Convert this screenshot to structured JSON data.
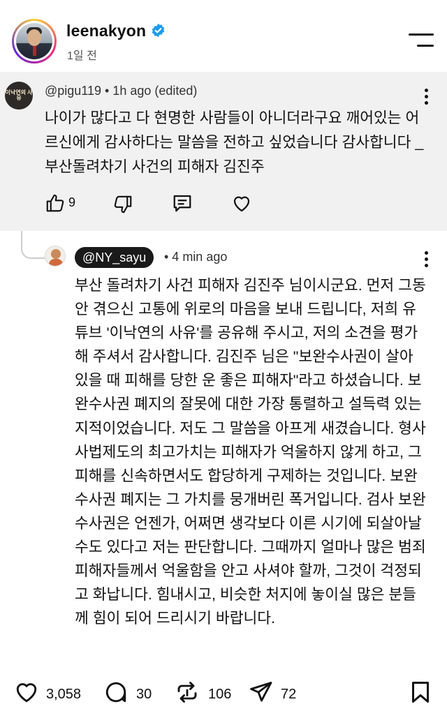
{
  "post": {
    "username": "leenakyon",
    "time": "1일 전"
  },
  "quoted_comment": {
    "handle": "@pigu119 • 1h ago (edited)",
    "avatar_text": "이낙연의 사유",
    "body": "나이가 많다고 다 현명한 사람들이 아니더라구요 깨어있는 어르신에게 감사하다는 말씀을 전하고 싶었습니다 감사합니다 _ 부산돌려차기 사건의 피해자 김진주",
    "like_count": "9"
  },
  "reply": {
    "handle": "@NY_sayu",
    "time": "• 4 min ago",
    "body": "부산 돌려차기 사건 피해자 김진주 님이시군요.  먼저 그동안 겪으신 고통에 위로의 마음을 보내 드립니다, 저희 유튜브 '이낙연의 사유'를 공유해 주시고, 저의 소견을 평가해 주셔서 감사합니다. 김진주 님은 \"보완수사권이 살아 있을 때 피해를 당한 운 좋은 피해자\"라고 하셨습니다. 보완수사권 폐지의 잘못에 대한 가장 통렬하고 설득력 있는 지적이었습니다. 저도 그 말씀을 아프게 새겼습니다. 형사사법제도의 최고가치는 피해자가 억울하지 않게 하고, 그 피해를 신속하면서도 합당하게 구제하는 것입니다. 보완수사권 폐지는 그 가치를 뭉개버린 폭거입니다. 검사 보완수사권은 언젠가, 어쩌면 생각보다 이른 시기에 되살아날 수도 있다고 저는 판단합니다. 그때까지 얼마나 많은 범죄 피해자들께서 억울함을 안고 사셔야 할까, 그것이 걱정되고 화납니다. 힘내시고, 비슷한 처지에 놓이실 많은 분들께 힘이 되어 드리시기 바랍니다."
  },
  "actions": {
    "likes": "3,058",
    "comments": "30",
    "reposts": "106",
    "shares": "72"
  },
  "colors": {
    "verified": "#1d9bf0",
    "quote_bg": "#f1f1f1",
    "pill_bg": "#1a1a1a"
  },
  "icons": [
    "verified-badge-icon",
    "menu-icon",
    "more-dots-icon",
    "thumbs-up-icon",
    "thumbs-down-icon",
    "comment-icon",
    "heart-icon",
    "repost-icon",
    "share-icon",
    "bookmark-icon"
  ]
}
